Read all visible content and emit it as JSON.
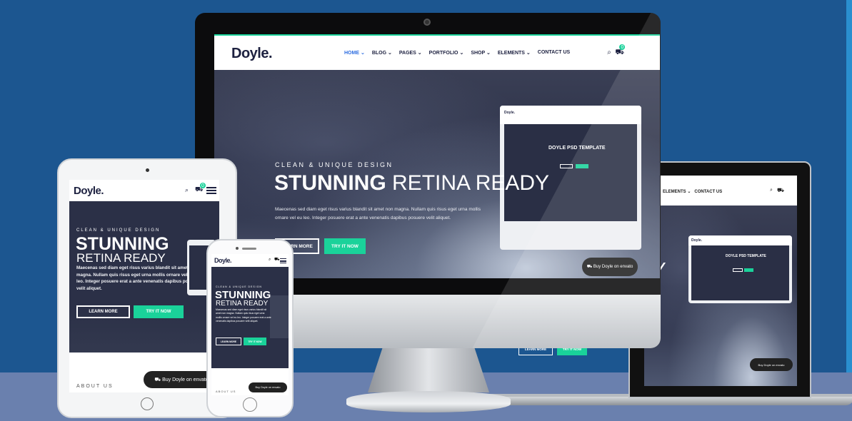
{
  "brand": {
    "name": "Doyle.",
    "accent": "#1ad29a",
    "active_link": "#2d6de0",
    "background": "#1c5690"
  },
  "nav": {
    "items": [
      "HOME",
      "BLOG",
      "PAGES",
      "PORTFOLIO",
      "SHOP",
      "ELEMENTS",
      "CONTACT US"
    ],
    "cart_count": "0"
  },
  "hero": {
    "kicker": "CLEAN & UNIQUE DESIGN",
    "title_bold": "STUNNING",
    "title_light": "RETINA READY",
    "description": "Maecenas sed diam eget risus varius blandit sit amet non magna. Nullam quis risus eget urna mollis ornare vel eu leo. Integer posuere erat a ante venenatis dapibus posuere velit aliquet.",
    "btn_learn": "LEARN MORE",
    "btn_try": "TRY IT NOW"
  },
  "mini_monitor": {
    "title": "DOYLE PSD TEMPLATE"
  },
  "laptop_nav": {
    "items": [
      "ELEMENTS",
      "CONTACT US"
    ],
    "hero_fragment": "Y"
  },
  "buy": {
    "text": "Buy Doyle on envato",
    "prefix": "Buy",
    "name": "Doyle",
    "on": "on",
    "market": "envato"
  },
  "about": {
    "label": "ABOUT US"
  }
}
